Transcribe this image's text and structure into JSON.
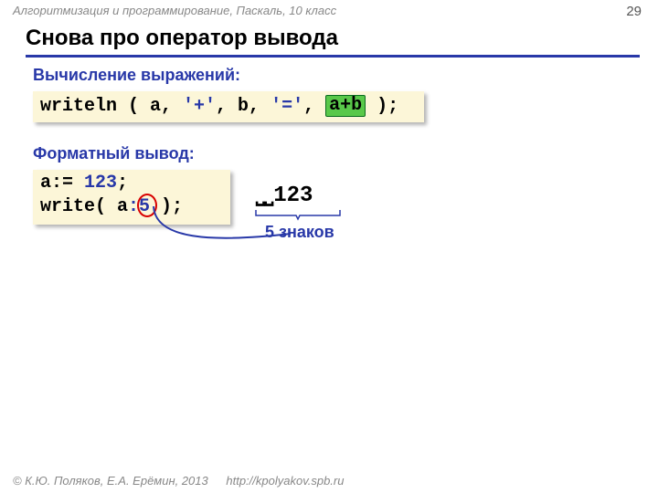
{
  "meta": {
    "header": "Алгоритмизация и программирование, Паскаль, 10 класс",
    "page": "29"
  },
  "title": "Снова про оператор вывода",
  "section1": {
    "heading": "Вычисление выражений:",
    "code": {
      "p1": "writeln ( a, ",
      "s1": "'+'",
      "p2": ", b, ",
      "s2": "'='",
      "p3": ", ",
      "hl": "a+b",
      "p4": " );"
    }
  },
  "section2": {
    "heading": "Форматный вывод:",
    "code": {
      "l1a": "a:= ",
      "l1b": "123",
      "l1c": ";",
      "l2a": "write( a",
      "l2b": ":",
      "l2c": "5",
      "l2d": " );"
    },
    "output": {
      "spaces": "⎵⎵",
      "value": "123"
    },
    "annotation": "5 знаков"
  },
  "footer": {
    "copyright": "© К.Ю. Поляков, Е.А. Ерёмин, 2013",
    "url": "http://kpolyakov.spb.ru"
  }
}
